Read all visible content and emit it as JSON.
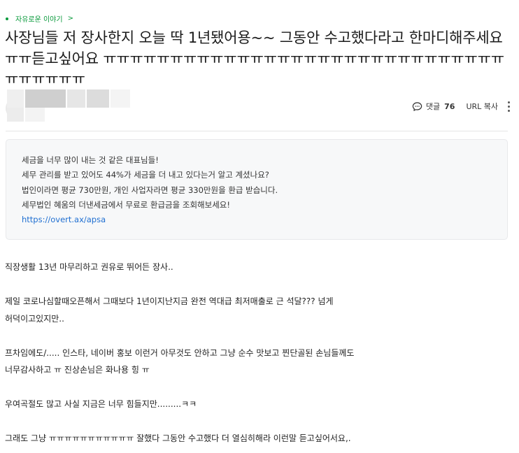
{
  "board": {
    "name": "자유로운 이야기",
    "chevron": ">"
  },
  "post": {
    "title": "사장님들 저 장사한지 오늘 딱 1년됐어용~~ 그동안 수고했다라고 한마디해주세요ㅠㅠ듣고싶어요 ㅠㅠㅠㅠㅠㅠㅠㅠㅠㅠㅠㅠㅠㅠㅠㅠㅠㅠㅠㅠㅠㅠㅠㅠㅠㅠㅠㅠㅠㅠㅠㅠㅠㅠㅠㅠ"
  },
  "actions": {
    "comment_label": "댓글",
    "comment_count": "76",
    "copy_url_label": "URL 복사"
  },
  "ad": {
    "lines": [
      "세금을 너무 많이 내는 것 같은 대표님들!",
      "세무 관리를 받고 있어도 44%가 세금을 더 내고 있다는거 알고 계셨나요?",
      "법인이라면 평균 730만원, 개인 사업자라면 평균 330만원을 환급 받습니다.",
      "세무법인 혜움의 더낸세금에서 무료로 환급금을 조회해보세요!"
    ],
    "link": "https://overt.ax/apsa"
  },
  "body": {
    "p1": "직장생활 13년 마무리하고 권유로 뛰어든 장사..",
    "p2a": "제일 코로나심할때오픈해서 그때보다 1년이지난지금 완전 역대급 최저매출로 근 석달??? 넘게",
    "p2b": "허덕이고있지만..",
    "p3a": "프차임에도/..... 인스타, 네이버 홍보 이런거 아무것도 안하고 그냥 순수 맛보고 찐단골된 손님들께도",
    "p3b": "너무감사하고 ㅠ 진상손님은 화나용 힝 ㅠ",
    "p4": "우여곡절도 많고 사실 지금은 너무 힘들지만.........ㅋㅋ",
    "p5": "그래도 그냥 ㅠㅠㅠㅠㅠㅠㅠㅠㅠㅠㅠ 잘했다 그동안 수고했다 더 열심히해라 이런말 듣고싶어서요,."
  }
}
